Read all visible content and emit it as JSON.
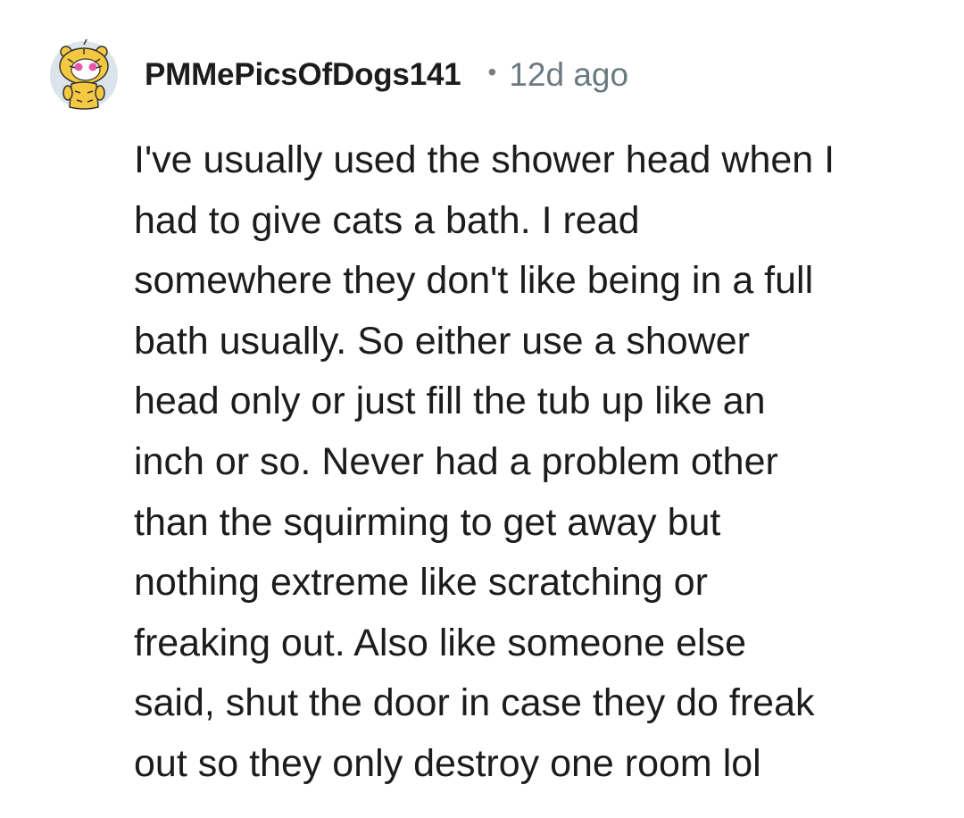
{
  "comment": {
    "username": "PMMePicsOfDogs141",
    "separator": "•",
    "timestamp": "12d ago",
    "avatar_icon": "tiger-snoo-avatar-icon",
    "body_lines": [
      "I've usually used the shower head when I",
      "had to give cats a bath. I read",
      "somewhere they don't like being in a full",
      "bath usually. So either use a shower",
      "head only or just fill the tub up like an",
      "inch or so. Never had a problem other",
      "than the squirming to get away but",
      "nothing extreme like scratching or",
      "freaking out. Also like someone else",
      "said, shut the door in case they do freak",
      "out so they only destroy one room lol"
    ]
  },
  "colors": {
    "background": "#ffffff",
    "text": "#1c1c1c",
    "meta": "#6b7a80",
    "avatar_bg": "#dbe4ea",
    "avatar_fur": "#f5c842"
  }
}
